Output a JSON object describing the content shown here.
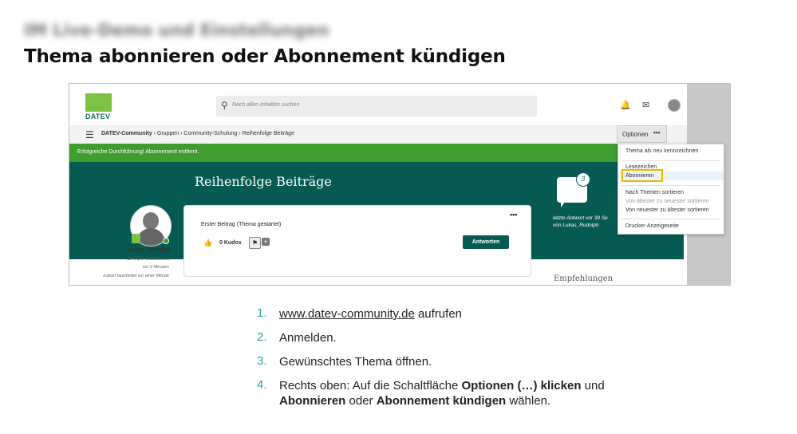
{
  "header": {
    "blurred_title": "IM Live-Demo und Einstellungen",
    "title": "Thema abonnieren oder Abonnement kündigen"
  },
  "app": {
    "logo_text": "DATEV",
    "search_placeholder": "Nach allen Inhalten suchen",
    "breadcrumb": {
      "root": "DATEV-Community",
      "items": [
        "Gruppen",
        "Community-Schulung",
        "Reihenfolge Beiträge"
      ],
      "separator": "›"
    },
    "options_label": "Optionen",
    "options_dots": "•••",
    "success_message": "Erfolgreiche Durchführung! Abonnement entfernt.",
    "topic_title": "Reihenfolge Beiträge",
    "reply_count": "3",
    "last_answer_line1": "letzte Antwort vor 39 Se",
    "last_answer_line2": "von Lukas_Rudolph",
    "post_label": "Erster Beitrag (Thema gestartet)",
    "kudos": "0 Kudos",
    "card_menu": "•••",
    "reply_button": "Antworten",
    "author": {
      "name": "Lukas_Rudolph",
      "role": "DATEV-Mitarbeiter",
      "time": "vor 2 Minuten",
      "edited": "zuletzt bearbeitet vor einer Minute"
    },
    "recommendations": "Empfehlungen",
    "menu": {
      "mark_new": "Thema als neu kennzeichnen",
      "bookmark": "Lesezeichen",
      "subscribe": "Abonnieren",
      "sort_topics": "Nach Themen sortieren",
      "oldest_newest": "Von ältester zu neuester sortieren",
      "newest_oldest": "Von neuester zu ältester sortieren",
      "print": "Drucker-Anzeigeseite"
    }
  },
  "steps": [
    {
      "num": "1.",
      "link": "www.datev-community.de",
      "text": " aufrufen"
    },
    {
      "num": "2.",
      "text": "Anmelden."
    },
    {
      "num": "3.",
      "text": "Gewünschtes Thema öffnen."
    },
    {
      "num": "4.",
      "a": "Rechts oben: Auf die Schaltfläche ",
      "b": "Optionen (…) klicken",
      "c": " und",
      "d": "Abonnieren",
      "e": " oder ",
      "f": "Abonnement kündigen",
      "g": " wählen."
    }
  ],
  "colors": {
    "teal": "#055b53",
    "green": "#3f9d2e",
    "logo_green": "#7dc243",
    "highlight": "#f2b500",
    "step_num": "#2a9fa8"
  }
}
